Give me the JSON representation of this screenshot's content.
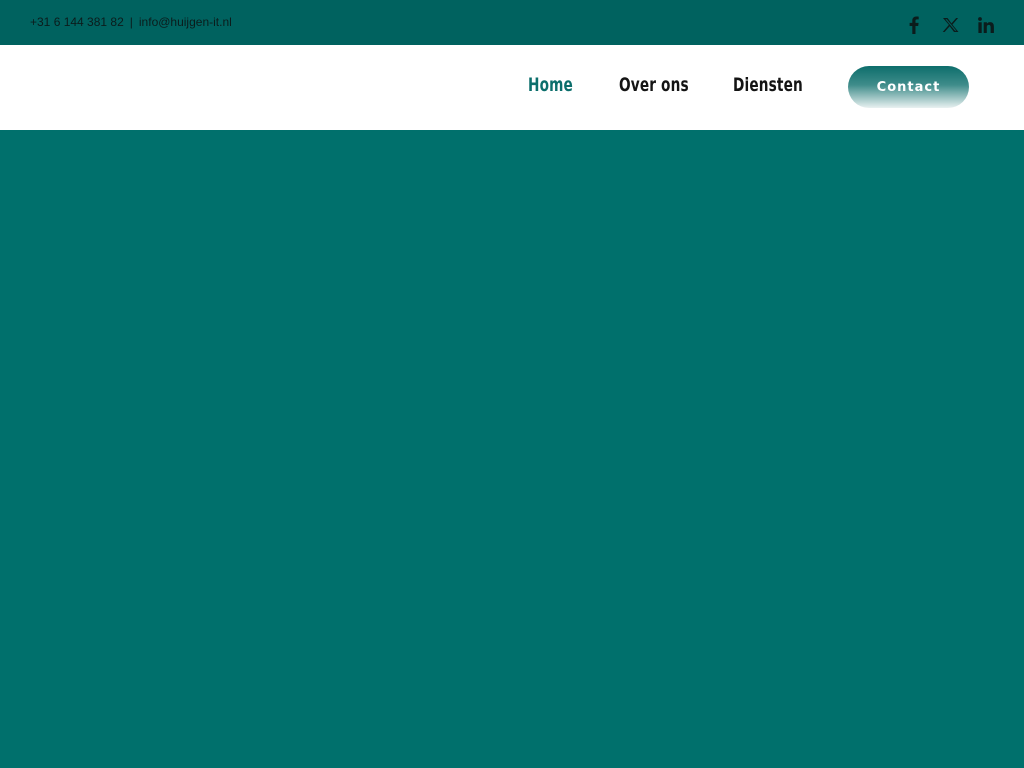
{
  "topbar": {
    "phone": "+31 6 144 381 82",
    "separator": "|",
    "email": "info@huijgen-it.nl",
    "social": [
      {
        "icon": "facebook-icon"
      },
      {
        "icon": "x-twitter-icon"
      },
      {
        "icon": "linkedin-icon"
      }
    ]
  },
  "nav": {
    "items": [
      {
        "label": "Home",
        "active": true
      },
      {
        "label": "Over ons",
        "active": false
      },
      {
        "label": "Diensten",
        "active": false
      }
    ],
    "contact_label": "Contact"
  },
  "colors": {
    "topbar_bg": "#00625f",
    "hero_bg": "#00706c",
    "accent": "#0b6e6b",
    "header_bg": "#ffffff"
  }
}
